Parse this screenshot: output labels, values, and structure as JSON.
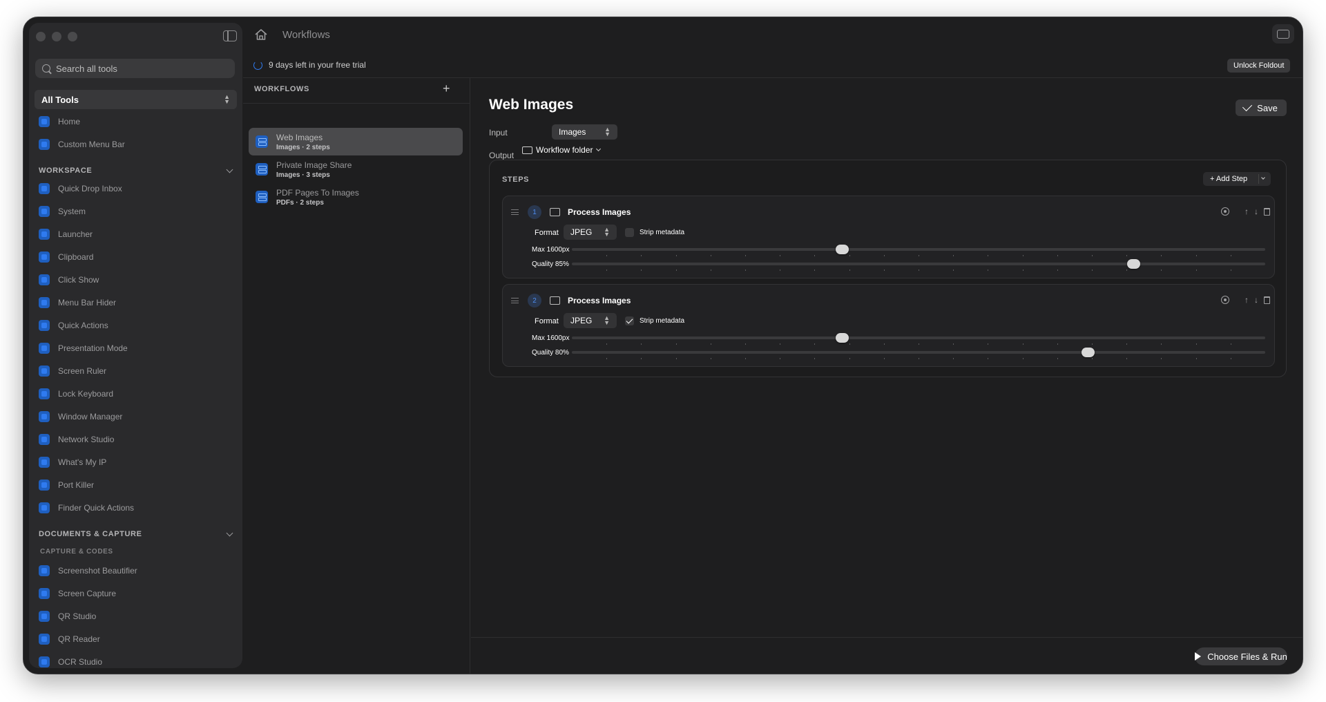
{
  "window": {
    "title": "Workflows"
  },
  "search": {
    "placeholder": "Search all tools"
  },
  "tools_filter": {
    "selected": "All Tools"
  },
  "sidebar": {
    "top_items": [
      {
        "label": "Home",
        "icon": "house-icon"
      },
      {
        "label": "Custom Menu Bar",
        "icon": "menubar-icon"
      }
    ],
    "sections": [
      {
        "title": "WORKSPACE",
        "items": [
          "Quick Drop Inbox",
          "System",
          "Launcher",
          "Clipboard",
          "Click Show",
          "Menu Bar Hider",
          "Quick Actions",
          "Presentation Mode",
          "Screen Ruler",
          "Lock Keyboard",
          "Window Manager",
          "Network Studio",
          "What's My IP",
          "Port Killer",
          "Finder Quick Actions"
        ]
      },
      {
        "title": "DOCUMENTS & CAPTURE",
        "subheader": "CAPTURE & CODES",
        "items": [
          "Screenshot Beautifier",
          "Screen Capture",
          "QR Studio",
          "QR Reader",
          "OCR Studio"
        ]
      }
    ]
  },
  "trial": {
    "text": "9 days left in your free trial",
    "unlock_label": "Unlock Foldout"
  },
  "workflows": {
    "header": "WORKFLOWS",
    "add_label": "+",
    "items": [
      {
        "title": "Web Images",
        "subtitle": "Images · 2 steps",
        "active": true
      },
      {
        "title": "Private Image Share",
        "subtitle": "Images · 3 steps",
        "active": false
      },
      {
        "title": "PDF Pages To Images",
        "subtitle": "PDFs · 2 steps",
        "active": false
      }
    ]
  },
  "editor": {
    "title": "Web Images",
    "save_label": "Save",
    "input_label": "Input",
    "input_value": "Images",
    "output_label": "Output",
    "output_value": "Workflow folder",
    "steps_label": "STEPS",
    "add_step_label": "+ Add Step",
    "steps": [
      {
        "number": "1",
        "title": "Process Images",
        "format_label": "Format",
        "format": "JPEG",
        "strip_label": "Strip metadata",
        "strip_checked": false,
        "max_label": "Max 1600px",
        "max_fraction": 0.39,
        "quality_label": "Quality 85%",
        "quality_fraction": 0.81
      },
      {
        "number": "2",
        "title": "Process Images",
        "format_label": "Format",
        "format": "JPEG",
        "strip_label": "Strip metadata",
        "strip_checked": true,
        "max_label": "Max 1600px",
        "max_fraction": 0.39,
        "quality_label": "Quality 80%",
        "quality_fraction": 0.745
      }
    ],
    "run_label": "Choose Files & Run"
  },
  "colors": {
    "accent": "#2f7bf0",
    "background": "#1e1e1f",
    "sidebar": "#2a2a2c"
  }
}
